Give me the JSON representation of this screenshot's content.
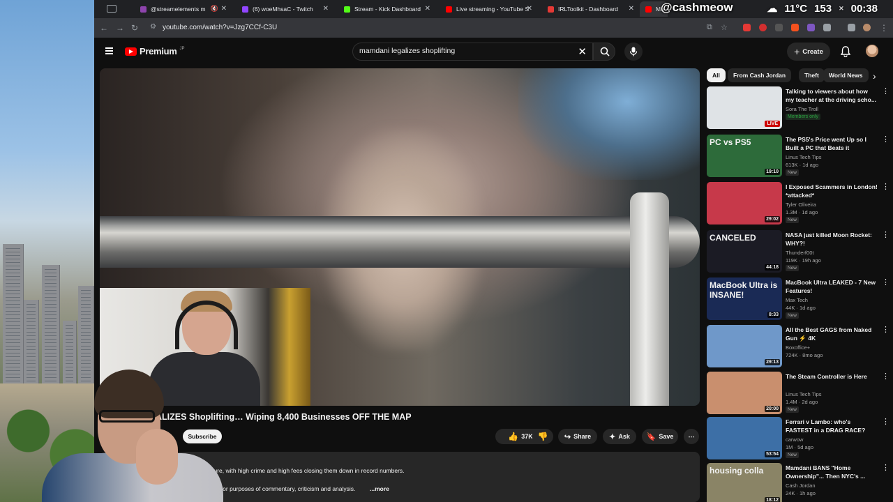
{
  "browser": {
    "tabs": [
      {
        "label": "@streamelements m",
        "favicon_color": "#8e44ad",
        "active": false
      },
      {
        "label": "(6) woeMhsaC - Twitch",
        "favicon_color": "#9146ff",
        "active": false
      },
      {
        "label": "Stream - Kick Dashboard",
        "favicon_color": "#53fc18",
        "active": false
      },
      {
        "label": "Live streaming - YouTube S",
        "favicon_color": "#ff0000",
        "active": false
      },
      {
        "label": "IRLToolkit - Dashboard",
        "favicon_color": "#e53935",
        "active": false
      },
      {
        "label": "Ma",
        "favicon_color": "#ff0000",
        "active": true
      }
    ],
    "url": "youtube.com/watch?v=Jzg7CCf-C3U"
  },
  "stream_overlay": {
    "handle": "@cashmeow",
    "temperature": "11°C",
    "viewers": "153",
    "time": "00:38"
  },
  "youtube": {
    "logo_text": "Premium",
    "logo_region": "JP",
    "search_value": "mamdani legalizes shoplifting",
    "create_label": "Create",
    "video": {
      "title": "ALIZES Shoplifting… Wiping 8,400 Businesses OFF THE MAP",
      "subscribe_label": "Subscribe",
      "likes": "37K",
      "share_label": "Share",
      "ask_label": "Ask",
      "save_label": "Save",
      "description_line1": "future, with high crime and high fees closing them down in record numbers.",
      "description_line2": "ge for purposes of commentary, criticism and analysis.",
      "more_label": "...more"
    },
    "chips": [
      "All",
      "From Cash Jordan",
      "Theft",
      "World News"
    ],
    "recommendations": [
      {
        "title": "Talking to viewers about how my teacher at the driving scho...",
        "channel": "Sora The Troll",
        "meta": "",
        "badge": "Members only",
        "duration": "LIVE",
        "thumb_text": "",
        "thumb_color": "#dfe3e6"
      },
      {
        "title": "The PS5's Price went Up so I Built a PC that Beats it",
        "channel": "Linus Tech Tips",
        "meta": "613K · 1d ago",
        "badge": "New",
        "duration": "19:10",
        "thumb_text": "PC vs PS5",
        "thumb_color": "#2d6b3a"
      },
      {
        "title": "I Exposed Scammers in London! *attacked*",
        "channel": "Tyler Oliveira",
        "meta": "1.3M · 1d ago",
        "badge": "New",
        "duration": "29:02",
        "thumb_text": "",
        "thumb_color": "#c7394a"
      },
      {
        "title": "NASA just killed Moon Rocket: WHY?!",
        "channel": "Thunderf00t",
        "meta": "119K · 19h ago",
        "badge": "New",
        "duration": "44:18",
        "thumb_text": "CANCELED",
        "thumb_color": "#1b1b24"
      },
      {
        "title": "MacBook Ultra LEAKED - 7 New Features!",
        "channel": "Max Tech",
        "meta": "44K · 1d ago",
        "badge": "New",
        "duration": "8:33",
        "thumb_text": "MacBook Ultra is INSANE!",
        "thumb_color": "#1a2a55"
      },
      {
        "title": "All the Best GAGS from Naked Gun ⚡ 4K",
        "channel": "Boxoffice+",
        "meta": "724K · 8mo ago",
        "badge": "",
        "duration": "29:13",
        "thumb_text": "",
        "thumb_color": "#6f98c9"
      },
      {
        "title": "The Steam Controller is Here",
        "channel": "Linus Tech Tips",
        "meta": "1.4M · 2d ago",
        "badge": "New",
        "duration": "20:00",
        "thumb_text": "",
        "thumb_color": "#c98f6e"
      },
      {
        "title": "Ferrari v Lambo: who's FASTEST in a DRAG RACE?",
        "channel": "carwow",
        "meta": "1M · 5d ago",
        "badge": "New",
        "duration": "53:54",
        "thumb_text": "",
        "thumb_color": "#3d6fa6"
      },
      {
        "title": "Mamdani BANS \"Home Ownership\"... Then NYC's ...",
        "channel": "Cash Jordan",
        "meta": "24K · 1h ago",
        "badge": "",
        "duration": "18:12",
        "thumb_text": "housing colla",
        "thumb_color": "#8a8466"
      }
    ]
  }
}
